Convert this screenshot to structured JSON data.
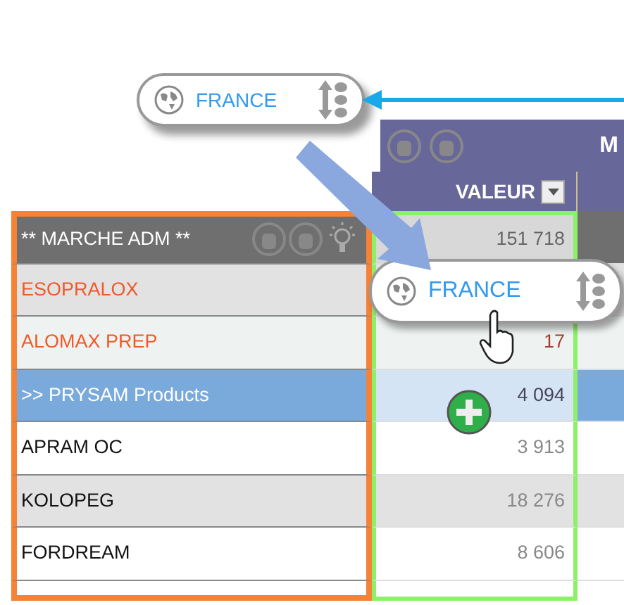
{
  "header": {
    "group_label": "M",
    "column_label": "VALEUR"
  },
  "rows": [
    {
      "label": "** MARCHE ADM **",
      "value": "151 718",
      "kind": "group"
    },
    {
      "label": "ESOPRALOX",
      "kind": "flagged",
      "shaded": true
    },
    {
      "label": "ALOMAX PREP",
      "value": "17",
      "kind": "flagged",
      "shaded": false
    },
    {
      "label": ">> PRYSAM Products",
      "value": "4 094",
      "kind": "subgroup"
    },
    {
      "label": "APRAM OC",
      "value": "3 913",
      "kind": "plain",
      "shaded": false
    },
    {
      "label": "KOLOPEG",
      "value": "18 276",
      "kind": "plain",
      "shaded": true
    },
    {
      "label": "FORDREAM",
      "value": "8 606",
      "kind": "plain",
      "shaded": false
    }
  ],
  "drag_chips": [
    {
      "label": "FRANCE",
      "kind": "source"
    },
    {
      "label": "FRANCE",
      "kind": "dragging"
    }
  ]
}
